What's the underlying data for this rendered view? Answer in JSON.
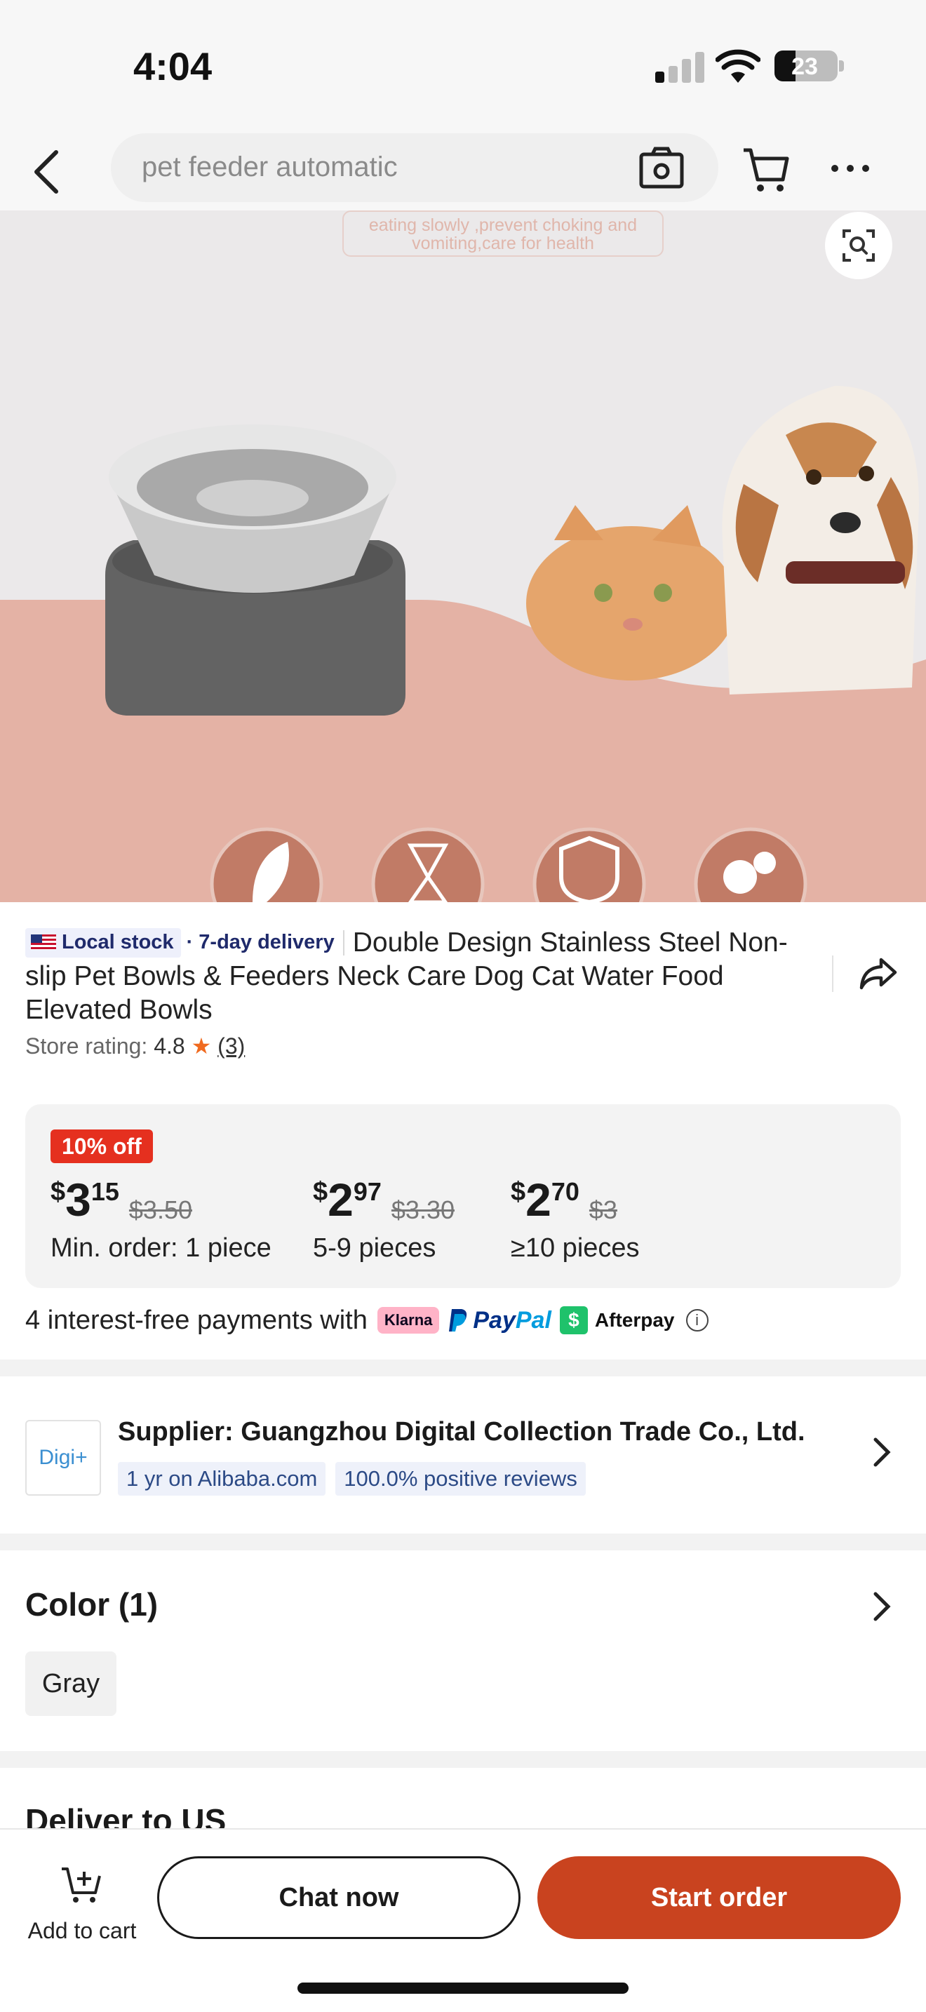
{
  "status_bar": {
    "time": "4:04",
    "battery_percent": "23",
    "signal_bars_active": 1,
    "signal_bars_total": 4
  },
  "header": {
    "search_text": "pet feeder automatic",
    "icons": [
      "back-arrow-icon",
      "camera-icon",
      "cart-icon",
      "more-icon"
    ]
  },
  "hero": {
    "tagline": "eating slowly ,prevent choking and vomiting,care for health",
    "accent_color": "#e4b2a5",
    "feature_icons": [
      "leaf-icon",
      "hourglass-icon",
      "shield-icon",
      "pets-icon"
    ]
  },
  "product": {
    "badge_local": "Local stock",
    "badge_delivery": "· 7-day delivery",
    "title": "Double Design Stainless Steel Non-slip Pet Bowls & Feeders Neck Care Dog Cat Water Food Elevated Bowls",
    "rating_label": "Store rating:",
    "rating_value": "4.8",
    "rating_star": "★",
    "rating_count": "(3)"
  },
  "pricing": {
    "discount": "10% off",
    "tiers": [
      {
        "currency": "$",
        "whole": "3",
        "cents": "15",
        "original": "$3.50",
        "qty": "Min. order: 1 piece"
      },
      {
        "currency": "$",
        "whole": "2",
        "cents": "97",
        "original": "$3.30",
        "qty": "5-9 pieces"
      },
      {
        "currency": "$",
        "whole": "2",
        "cents": "70",
        "original": "$3",
        "qty": "≥10 pieces"
      }
    ]
  },
  "payments": {
    "text": "4 interest-free payments with",
    "klarna": "Klarna",
    "paypal_a": "Pay",
    "paypal_b": "Pal",
    "afterpay_icon": "$",
    "afterpay": "Afterpay",
    "info": "i"
  },
  "supplier": {
    "logo": "Digi+",
    "name": "Supplier:  Guangzhou Digital Collection Trade Co., Ltd.",
    "tag_years": "1 yr on Alibaba.com",
    "tag_reviews": "100.0% positive reviews"
  },
  "color": {
    "title": "Color (1)",
    "option": "Gray"
  },
  "deliver": {
    "title": "Deliver to US"
  },
  "bottom": {
    "add_to_cart": "Add to cart",
    "chat": "Chat now",
    "order": "Start order",
    "brand_color": "#c9431f"
  }
}
